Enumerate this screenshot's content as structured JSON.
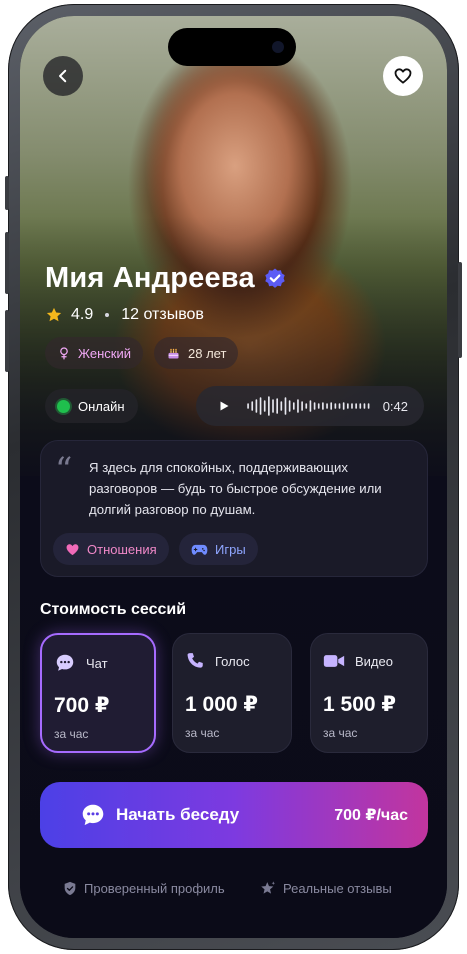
{
  "profile": {
    "name": "Мия Андреева",
    "rating": "4.9",
    "reviews": "12 отзывов",
    "gender": "Женский",
    "age": "28 лет",
    "status": "Онлайн",
    "audio_duration": "0:42"
  },
  "bio": {
    "text": "Я здесь для спокойных, поддерживающих разговоров — будь то быстрое обсуждение или долгий разговор по душам.",
    "tags": [
      "Отношения",
      "Игры"
    ]
  },
  "pricing": {
    "title": "Стоимость сессий",
    "selected": "chat",
    "options": [
      {
        "label": "Чат",
        "price": "700 ₽",
        "unit": "за час",
        "icon": "chat-bubble-icon"
      },
      {
        "label": "Голос",
        "price": "1 000 ₽",
        "unit": "за час",
        "icon": "phone-icon"
      },
      {
        "label": "Видео",
        "price": "1 500 ₽",
        "unit": "за час",
        "icon": "video-camera-icon"
      }
    ]
  },
  "cta": {
    "label": "Начать беседу",
    "price": "700 ₽/час"
  },
  "footer": {
    "verified": "Проверенный профиль",
    "reviews": "Реальные отзывы"
  },
  "colors": {
    "accent_purple": "#a66bff",
    "cta_gradient_start": "#4c40e6",
    "cta_gradient_end": "#c2359e",
    "online_green": "#1fbf4d",
    "verified_blue": "#5b5bf5",
    "star": "#f5b81c"
  }
}
